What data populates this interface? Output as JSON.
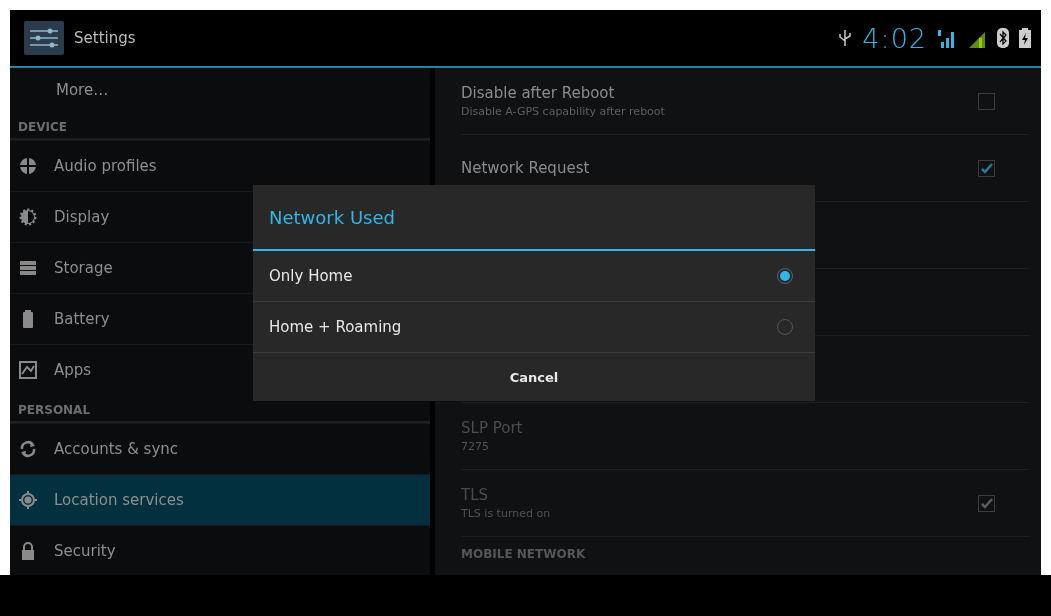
{
  "action_bar": {
    "title": "Settings"
  },
  "status_bar": {
    "time": "4:02"
  },
  "sidebar": {
    "items": [
      {
        "kind": "item",
        "label": "More…",
        "selected": false
      },
      {
        "kind": "header",
        "label": "DEVICE"
      },
      {
        "kind": "item",
        "label": "Audio profiles",
        "selected": false
      },
      {
        "kind": "item",
        "label": "Display",
        "selected": false
      },
      {
        "kind": "item",
        "label": "Storage",
        "selected": false
      },
      {
        "kind": "item",
        "label": "Battery",
        "selected": false
      },
      {
        "kind": "item",
        "label": "Apps",
        "selected": false
      },
      {
        "kind": "header",
        "label": "PERSONAL"
      },
      {
        "kind": "item",
        "label": "Accounts & sync",
        "selected": false
      },
      {
        "kind": "item",
        "label": "Location services",
        "selected": true
      },
      {
        "kind": "item",
        "label": "Security",
        "selected": false
      }
    ]
  },
  "preferences": [
    {
      "kind": "checkbox",
      "title": "Disable after Reboot",
      "summary": "Disable A-GPS capability after reboot",
      "checked": false,
      "disabled": false
    },
    {
      "kind": "checkbox",
      "title": "Network Request",
      "checked": true,
      "disabled": false
    },
    {
      "kind": "hidden"
    },
    {
      "kind": "hidden"
    },
    {
      "kind": "hidden"
    },
    {
      "kind": "text",
      "title": "SLP Port",
      "summary": "7275",
      "disabled": true
    },
    {
      "kind": "checkbox",
      "title": "TLS",
      "summary": "TLS is turned on",
      "checked": true,
      "disabled": true
    },
    {
      "kind": "header",
      "title": "MOBILE NETWORK"
    }
  ],
  "dialog": {
    "title": "Network Used",
    "options": [
      {
        "label": "Only Home",
        "selected": true
      },
      {
        "label": "Home + Roaming",
        "selected": false
      }
    ],
    "button": "Cancel"
  }
}
